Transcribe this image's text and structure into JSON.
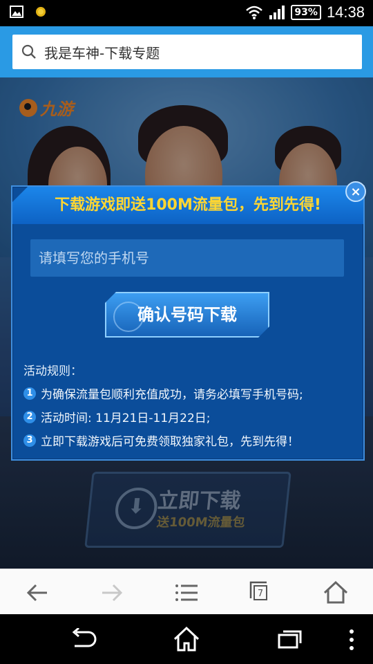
{
  "status_bar": {
    "battery": "93%",
    "time": "14:38"
  },
  "address_bar": {
    "title": "我是车神-下载专题"
  },
  "page": {
    "logo_text": "九游",
    "bg_download": {
      "main": "立即下载",
      "sub": "送100M流量包"
    }
  },
  "modal": {
    "header": "下载游戏即送100M流量包，先到先得!",
    "phone_placeholder": "请填写您的手机号",
    "confirm_label": "确认号码下载",
    "close_label": "×",
    "rules_title": "活动规则：",
    "rules": [
      {
        "num": "1",
        "text": "为确保流量包顺利充值成功，请务必填写手机号码;"
      },
      {
        "num": "2",
        "text": "活动时间: 11月21日-11月22日;"
      },
      {
        "num": "3",
        "text": "立即下载游戏后可免费领取独家礼包，先到先得！"
      }
    ]
  },
  "toolbar": {
    "tabs_count": "7",
    "icons": [
      "back-icon",
      "forward-icon",
      "menu-icon",
      "tabs-icon",
      "home-icon"
    ]
  },
  "nav_bar": {
    "icons": [
      "nav-back-icon",
      "nav-home-icon",
      "nav-recents-icon",
      "nav-overflow-icon"
    ]
  },
  "colors": {
    "address_bar": "#2a9ae4",
    "modal_bg": "#0b4d9a",
    "header_text": "#ffd631"
  }
}
